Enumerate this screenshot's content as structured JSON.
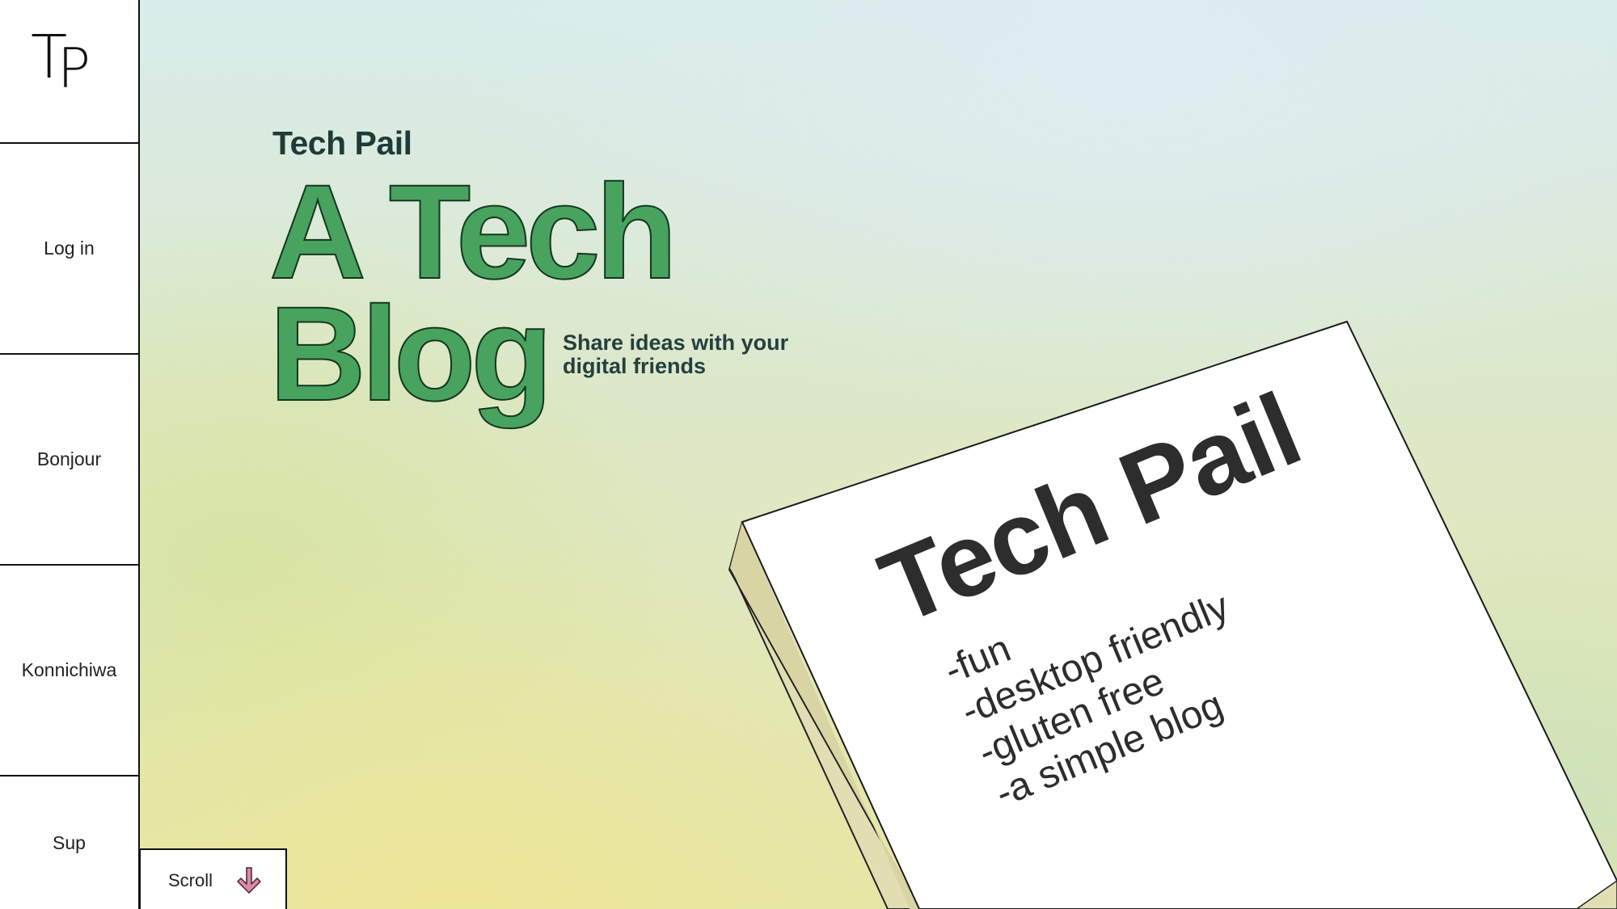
{
  "sidebar": {
    "logo": "TP",
    "items": [
      {
        "label": "Log in"
      },
      {
        "label": "Bonjour"
      },
      {
        "label": "Konnichiwa"
      },
      {
        "label": "Sup"
      }
    ]
  },
  "scroll": {
    "label": "Scroll",
    "icon": "arrow-down-icon"
  },
  "hero": {
    "brand": "Tech Pail",
    "headline_line1": "A Tech",
    "headline_line2": "Blog",
    "tagline": "Share ideas with your digital friends"
  },
  "book": {
    "title": "Tech Pail",
    "features": [
      "-fun",
      "-desktop friendly",
      "-gluten free",
      "-a simple blog"
    ]
  },
  "colors": {
    "headline": "#47a35e",
    "brand_text": "#1e3b38",
    "arrow": "#c66a8a"
  }
}
